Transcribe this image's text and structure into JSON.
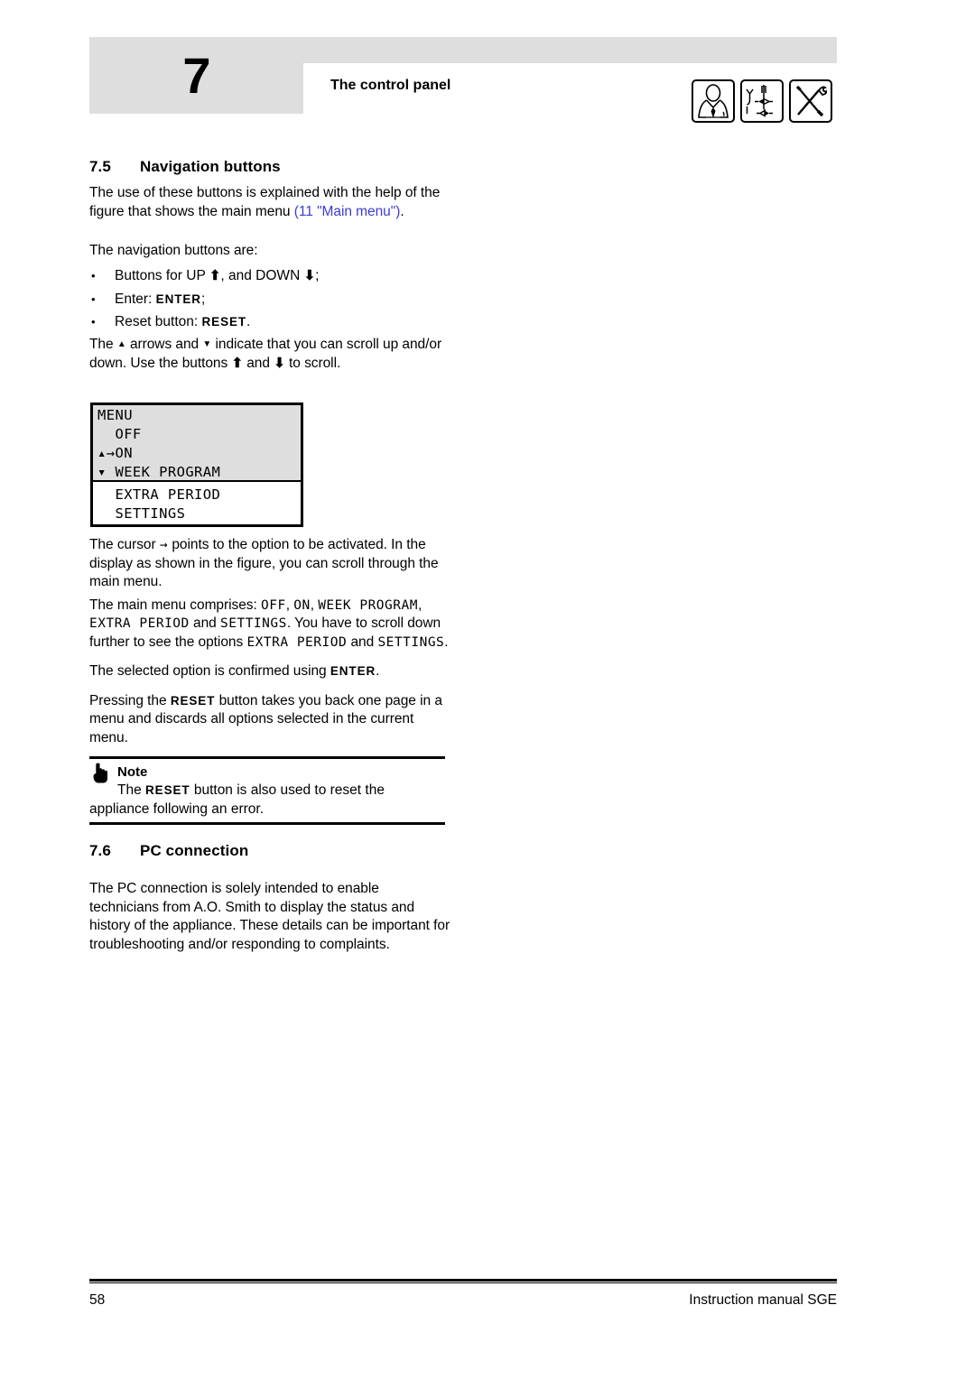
{
  "header": {
    "chapter_number": "7",
    "title": "The control panel",
    "icons": [
      {
        "name": "installer-person-icon",
        "label": "installer"
      },
      {
        "name": "gas-valve-schematic-icon",
        "label": "gas technician"
      },
      {
        "name": "crossed-tools-icon",
        "label": "service tools"
      }
    ]
  },
  "sections": {
    "nav": {
      "number": "7.5",
      "heading": "Navigation buttons",
      "p1_a": "The use of these buttons is explained with the help of the figure that shows the main menu ",
      "p1_link": "(11 \"Main menu\")",
      "p1_b": ".",
      "p2": "The navigation buttons are:",
      "bullets": [
        {
          "pre": "Buttons for UP ",
          "up": "⬆",
          "mid": ", and DOWN ",
          "down": "⬇",
          "post": ";"
        },
        {
          "pre": "Enter: ",
          "kbd": "ENTER",
          "post": ";"
        },
        {
          "pre": "Reset button: ",
          "kbd": "RESET",
          "post": "."
        }
      ],
      "p3_a": "The ",
      "p3_up": "▲",
      "p3_b": " arrows and ",
      "p3_down": "▼",
      "p3_c": " indicate that you can scroll up and/or down. Use the buttons ",
      "p3_up2": "⬆",
      "p3_d": " and ",
      "p3_down2": "⬇",
      "p3_e": " to scroll."
    },
    "lcd": {
      "screen_lines": [
        "MENU",
        "  OFF",
        "▴→ON",
        "▾ WEEK PROGRAM"
      ],
      "overflow_lines": [
        "  EXTRA PERIOD",
        "  SETTINGS"
      ]
    },
    "after_figure": {
      "p1_a": "The cursor ",
      "p1_cursor": "→",
      "p1_b": " points to the option to be activated. In the display as shown in the figure, you can scroll through the main menu.",
      "p2_a": "The main menu comprises: ",
      "p2_off": "OFF",
      "p2_c1": ", ",
      "p2_on": "ON",
      "p2_c2": ", ",
      "p2_week": "WEEK PROGRAM",
      "p2_c3": ", ",
      "p2_extra": "EXTRA PERIOD",
      "p2_and": " and ",
      "p2_settings": "SETTINGS",
      "p2_tail": ". You have to scroll down further to see the options ",
      "p2_extra2": "EXTRA PERIOD",
      "p2_and2": " and ",
      "p2_settings2": "SETTINGS",
      "p2_end": ".",
      "p3_a": "The selected option is confirmed using ",
      "p3_kbd": "ENTER",
      "p3_b": ".",
      "p4_a": "Pressing the ",
      "p4_kbd": "RESET",
      "p4_b": " button takes you back one page in a menu and discards all options selected in the current menu."
    },
    "note": {
      "title": "Note",
      "text_a": "The ",
      "text_kbd": "RESET",
      "text_b": " button is also used to reset the appliance following an error."
    },
    "pc": {
      "number": "7.6",
      "heading": "PC connection",
      "p1": "The PC connection is solely intended to enable technicians from A.O. Smith to display the status and history of the appliance. These details can be important for troubleshooting and/or responding to complaints."
    }
  },
  "footer": {
    "page_number": "58",
    "manual_title": "Instruction manual SGE"
  },
  "colors": {
    "band_gray": "#dedede",
    "link_blue": "#3c3cd8",
    "text_black": "#000000"
  }
}
